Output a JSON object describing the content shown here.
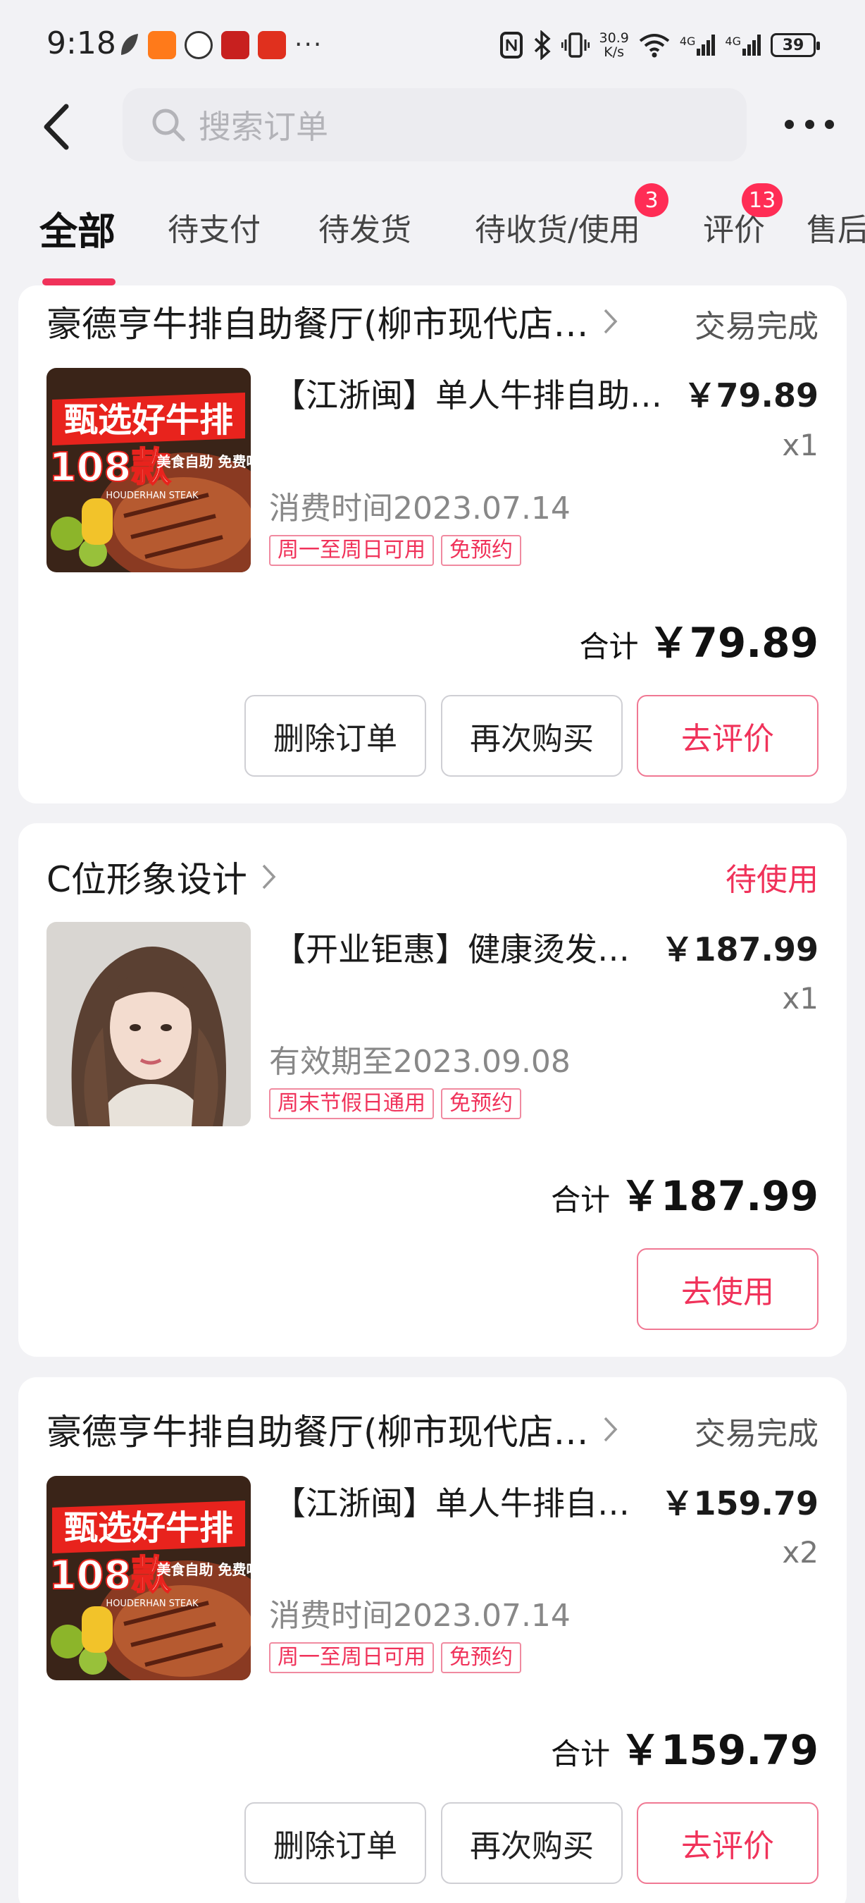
{
  "status_bar": {
    "time": "9:18",
    "network_speed": "30.9\nK/s",
    "speed_top": "30.9",
    "speed_bottom": "K/s",
    "signal_1": "4G",
    "signal_2": "4G",
    "battery": "39"
  },
  "search": {
    "placeholder": "搜索订单"
  },
  "tabs": [
    {
      "label": "全部"
    },
    {
      "label": "待支付"
    },
    {
      "label": "待发货"
    },
    {
      "label": "待收货/使用",
      "badge": "3"
    },
    {
      "label": "评价",
      "badge": "13"
    },
    {
      "label": "售后"
    }
  ],
  "orders": [
    {
      "shop": "豪德亨牛排自助餐厅(柳市现代店…",
      "status": "交易完成",
      "product_title": "【江浙闽】单人牛排自助…",
      "price": "￥79.89",
      "qty": "x1",
      "meta": "消费时间2023.07.14",
      "tags": [
        "周一至周日可用",
        "免预约"
      ],
      "total_label": "合计",
      "total": "￥79.89",
      "buttons": [
        "删除订单",
        "再次购买",
        "去评价"
      ],
      "image_text": {
        "line1": "甄选好牛排",
        "line2": "108款",
        "line3": "美食自助 免费吃",
        "line4": "HOUDERHAN STEAK"
      }
    },
    {
      "shop": "C位形象设计",
      "status": "待使用",
      "product_title": "【开业钜惠】健康烫发…",
      "price": "￥187.99",
      "qty": "x1",
      "meta": "有效期至2023.09.08",
      "tags": [
        "周末节假日通用",
        "免预约"
      ],
      "total_label": "合计",
      "total": "￥187.99",
      "buttons": [
        "去使用"
      ]
    },
    {
      "shop": "豪德亨牛排自助餐厅(柳市现代店…",
      "status": "交易完成",
      "product_title": "【江浙闽】单人牛排自…",
      "price": "￥159.79",
      "qty": "x2",
      "meta": "消费时间2023.07.14",
      "tags": [
        "周一至周日可用",
        "免预约"
      ],
      "total_label": "合计",
      "total": "￥159.79",
      "buttons": [
        "删除订单",
        "再次购买",
        "去评价"
      ],
      "image_text": {
        "line1": "甄选好牛排",
        "line2": "108款",
        "line3": "美食自助 免费吃",
        "line4": "HOUDERHAN STEAK"
      }
    }
  ],
  "colors": {
    "accent": "#f0325a",
    "badge": "#ff2d55",
    "background": "#f2f2f5"
  }
}
